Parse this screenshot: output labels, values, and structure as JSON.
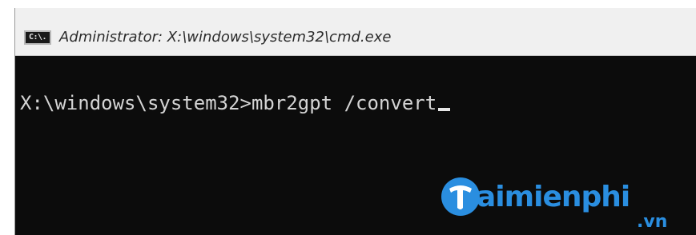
{
  "window": {
    "title": "Administrator: X:\\windows\\system32\\cmd.exe",
    "icon": "cmd-icon",
    "icon_label": "C:\\."
  },
  "console": {
    "prompt": "X:\\windows\\system32>",
    "command": "mbr2gpt /convert"
  },
  "watermark": {
    "brand": "aimienphi",
    "suffix": ".vn",
    "logo_letter": "T",
    "color": "#2a8ee0"
  },
  "colors": {
    "console_bg": "#0c0c0c",
    "console_text": "#d4d4d4",
    "titlebar_bg": "#f0f0f0"
  }
}
